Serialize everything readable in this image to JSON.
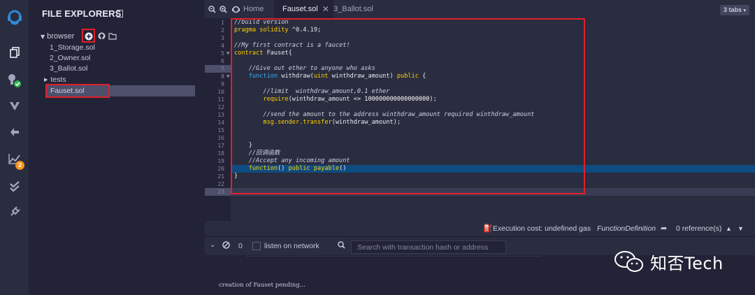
{
  "rail": {
    "icons": [
      "remix-logo-icon",
      "file-explorer-icon",
      "plugin-manager-icon",
      "solidity-compiler-icon",
      "deploy-run-icon",
      "analysis-icon",
      "test-icon",
      "settings-plug-icon"
    ],
    "analysis_badge": "2"
  },
  "explorer": {
    "title": "FILE EXPLORERS",
    "root_label": "browser",
    "files": [
      "1_Storage.sol",
      "2_Owner.sol",
      "3_Ballot.sol"
    ],
    "folder": "tests",
    "selected_file": "Fauset.sol"
  },
  "tabs": {
    "home_label": "Home",
    "active_label": "Fauset.sol",
    "other_label": "3_Ballot.sol",
    "count_label": "3 tabs"
  },
  "editor": {
    "line_numbers": [
      "1",
      "2",
      "3",
      "4",
      "5",
      "6",
      "7",
      "8",
      "9",
      "10",
      "11",
      "12",
      "13",
      "14",
      "15",
      "16",
      "17",
      "18",
      "19",
      "20",
      "21",
      "22",
      "23"
    ],
    "lines": {
      "l1": "//build version",
      "l2_kw": "pragma solidity",
      "l2_rest": " ^0.4.19;",
      "l4": "//My first contract is a faucet!",
      "l5_kw": "contract",
      "l5_rest": " Fauset{",
      "l7": "    //Give out ether to anyone who asks",
      "l8_kw": "    function",
      "l8_mid": " withdraw(",
      "l8_ty": "uint",
      "l8_rest": " winthdraw_amount) ",
      "l8_mod": "public",
      "l8_end": " {",
      "l10": "        //limit  winthdraw_amount,0.1 ether",
      "l11_kw": "        require",
      "l11_mid": "(winthdraw_amount <= ",
      "l11_num": "100000000000000000",
      "l11_end": ");",
      "l13": "        //send the amount to the address winthdraw_amount required winthdraw_amount",
      "l14_kw": "        msg.sender.transfer",
      "l14_rest": "(winthdraw_amount);",
      "l17": "    }",
      "l18": "    //回调函数",
      "l19": "    //Accept any incoming amount",
      "l20_kw": "    function",
      "l20_mid": "() ",
      "l20_mod": "public payable",
      "l20_end": "()",
      "l21": "}"
    }
  },
  "status": {
    "exec_cost": "Execution cost: undefined gas",
    "function_def": "FunctionDefinition",
    "references": "0 reference(s)"
  },
  "terminal": {
    "count": "0",
    "listen_label": "listen on network",
    "search_placeholder": "Search with transaction hash or address",
    "log_line": "creation of Fauset pending..."
  },
  "watermark": {
    "text": "知否Tech"
  }
}
